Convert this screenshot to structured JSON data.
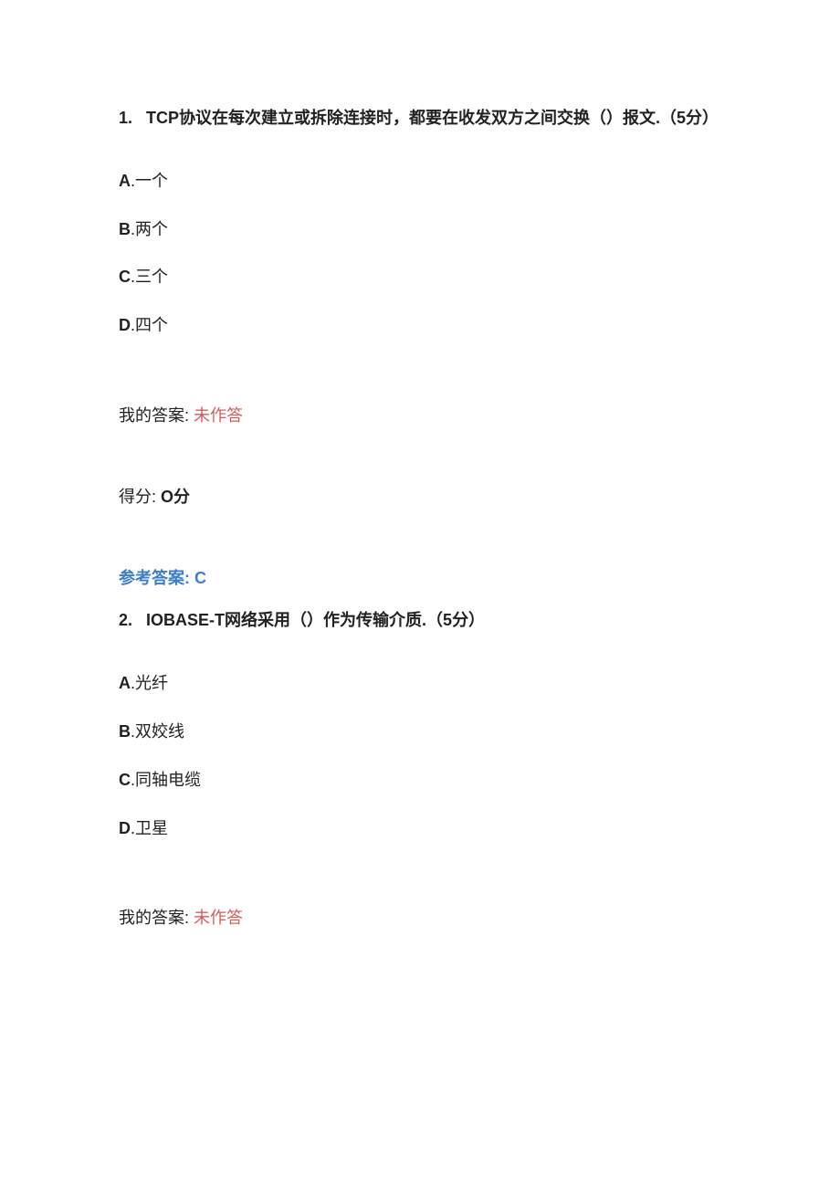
{
  "q1": {
    "number": "1.",
    "text_prefix_bold": "TCP",
    "text_rest": "协议在每次建立或拆除连接时，都要在收发双方之间交换（）报文.（",
    "points_bold": "5",
    "text_tail": "分）",
    "choices": {
      "A": {
        "letter": "A",
        "sep": ".",
        "text": "一个"
      },
      "B": {
        "letter": "B",
        "sep": ".",
        "text": "两个"
      },
      "C": {
        "letter": "C",
        "sep": ".",
        "text": "三个"
      },
      "D": {
        "letter": "D",
        "sep": ".",
        "text": "四个"
      }
    },
    "my_answer_label": "我的答案:",
    "my_answer_value": "未作答",
    "score_label": "得分:",
    "score_value": "O分",
    "reference_label": "参考答案:",
    "reference_value": "C"
  },
  "q2": {
    "number": "2.",
    "text_prefix_bold": "IOBASE-T",
    "text_rest": "网络采用（）作为传输介质.（",
    "points_bold": "5",
    "text_tail": "分）",
    "choices": {
      "A": {
        "letter": "A",
        "sep": ".",
        "text": "光纤"
      },
      "B": {
        "letter": "B",
        "sep": ".",
        "text": "双姣线"
      },
      "C": {
        "letter": "C",
        "sep": ".",
        "text": "同轴电缆"
      },
      "D": {
        "letter": "D",
        "sep": ".",
        "text": "卫星"
      }
    },
    "my_answer_label": "我的答案:",
    "my_answer_value": "未作答"
  }
}
